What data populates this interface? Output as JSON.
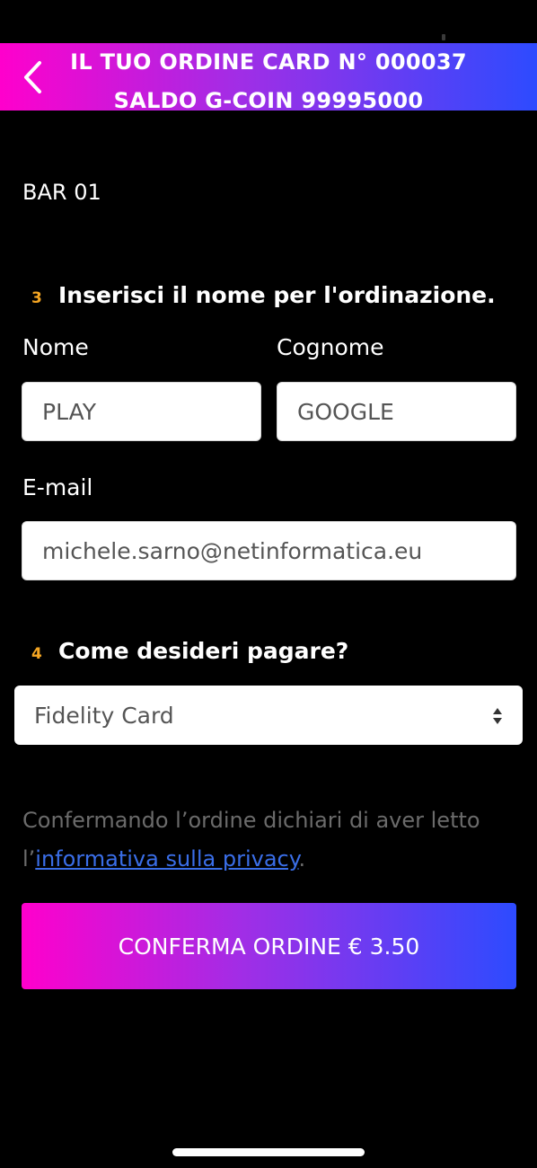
{
  "header": {
    "line1": "IL TUO ORDINE CARD N° 000037",
    "line2": "SALDO G-COIN 99995000",
    "back_icon": "chevron-left-icon"
  },
  "venue": "BAR 01",
  "name_section": {
    "step": "3",
    "title": "Inserisci il nome per l'ordinazione.",
    "first_name_label": "Nome",
    "first_name_value": "PLAY",
    "last_name_label": "Cognome",
    "last_name_value": "GOOGLE",
    "email_label": "E-mail",
    "email_value": "michele.sarno@netinformatica.eu"
  },
  "payment_section": {
    "step": "4",
    "title": "Come desideri pagare?",
    "selected": "Fidelity Card",
    "arrows_icon": "select-arrows-icon"
  },
  "privacy": {
    "text_before": "Confermando l’ordine dichiari di aver letto l’",
    "link": "informativa sulla privacy",
    "text_after": "."
  },
  "confirm_button": "CONFERMA ORDINE € 3.50",
  "colors": {
    "gradient_start": "#ff00cc",
    "gradient_end": "#2d4bff",
    "step_number": "#f5a623",
    "link": "#3a6ee8"
  }
}
